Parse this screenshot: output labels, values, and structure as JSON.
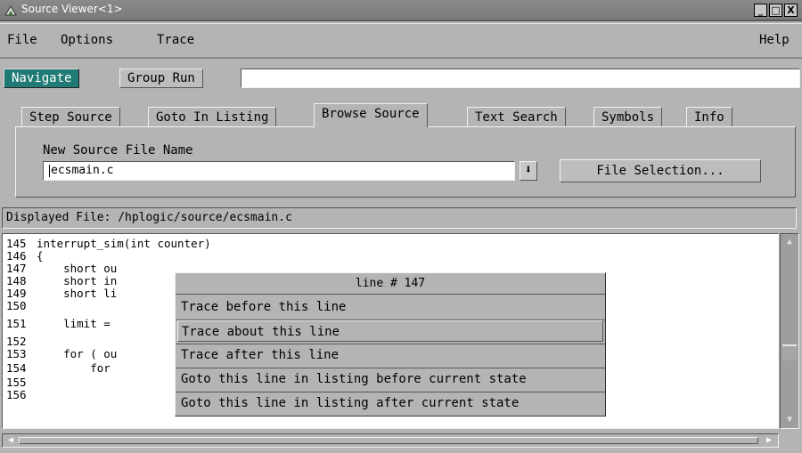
{
  "window": {
    "title": "Source Viewer<1>",
    "buttons": {
      "minimize": "_",
      "maximize": "□",
      "close": "X"
    }
  },
  "menu": {
    "file": "File",
    "options": "Options",
    "trace": "Trace",
    "help": "Help"
  },
  "modes": {
    "navigate": "Navigate",
    "group_run": "Group Run",
    "field_value": ""
  },
  "tabs": [
    {
      "label": "Step Source",
      "selected": false
    },
    {
      "label": "Goto In Listing",
      "selected": false
    },
    {
      "label": "Browse Source",
      "selected": true
    },
    {
      "label": "Text Search",
      "selected": false
    },
    {
      "label": "Symbols",
      "selected": false
    },
    {
      "label": "Info",
      "selected": false
    }
  ],
  "browse": {
    "field_label": "New Source File Name",
    "file_name": "ecsmain.c",
    "dropdown_glyph": "⬇",
    "file_selection_label": "File Selection..."
  },
  "status": {
    "displayed_file": "Displayed File: /hplogic/source/ecsmain.c"
  },
  "code": {
    "lines": [
      {
        "num": "145",
        "text": "interrupt_sim(int counter)"
      },
      {
        "num": "146",
        "text": "{"
      },
      {
        "num": "147",
        "text": "    short ou"
      },
      {
        "num": "148",
        "text": "    short in"
      },
      {
        "num": "149",
        "text": "    short li"
      },
      {
        "num": "150",
        "text": ""
      },
      {
        "num": "151",
        "text": "    limit ="
      },
      {
        "num": "152",
        "text": ""
      },
      {
        "num": "153",
        "text": "    for ( ou"
      },
      {
        "num": "154",
        "text": "        for"
      },
      {
        "num": "155",
        "text": ""
      },
      {
        "num": "156",
        "text": ""
      }
    ]
  },
  "popup": {
    "header": "line # 147",
    "items": [
      "Trace before this line",
      "Trace about this line",
      "Trace after this line",
      "Goto this line in listing before current state",
      "Goto this line in listing after current state"
    ],
    "highlighted_index": 1
  },
  "scrollbars": {
    "up": "▲",
    "down": "▼",
    "left": "◀",
    "right": "▶"
  },
  "colors": {
    "accent_teal": "#207b76",
    "background_gray": "#b4b4b4"
  }
}
